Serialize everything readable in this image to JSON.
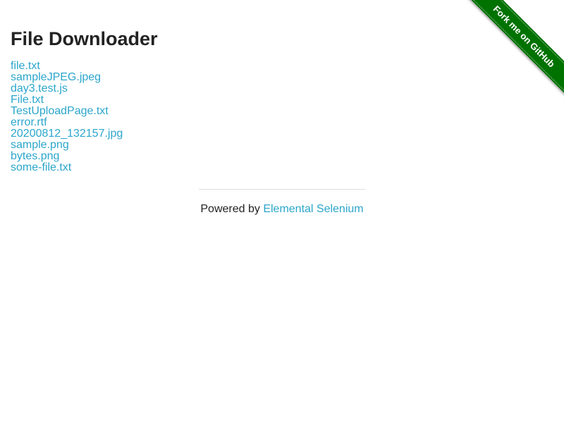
{
  "header": {
    "title": "File Downloader"
  },
  "files": [
    "file.txt",
    "sampleJPEG.jpeg",
    "day3.test.js",
    "File.txt",
    "TestUploadPage.txt",
    "error.rtf",
    "20200812_132157.jpg",
    "sample.png",
    "bytes.png",
    "some-file.txt"
  ],
  "footer": {
    "prefix": "Powered by ",
    "link_label": "Elemental Selenium"
  },
  "ribbon": {
    "label": "Fork me on GitHub",
    "color": "#007200"
  },
  "colors": {
    "link": "#2ba6cb",
    "text": "#222222",
    "divider": "#dddddd"
  }
}
